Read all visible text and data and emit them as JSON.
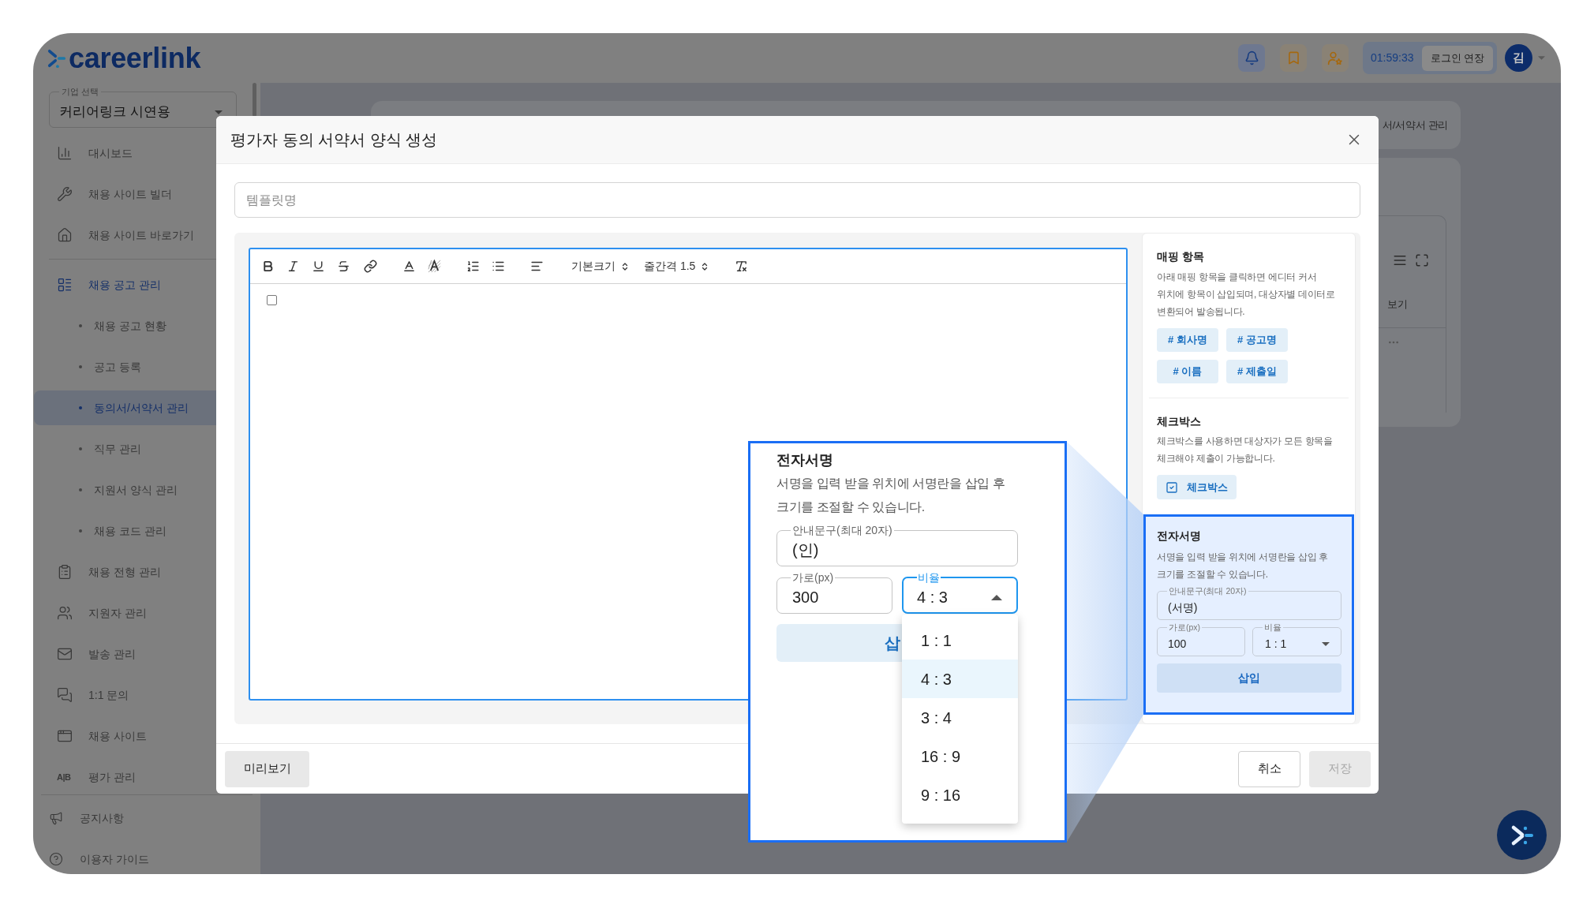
{
  "header": {
    "logo": "careerlink",
    "session_timer": "01:59:33",
    "extend_button": "로그인 연장",
    "avatar": "김"
  },
  "sidebar": {
    "company_select": {
      "label": "기업 선택",
      "value": "커리어링크 시연용"
    },
    "sections": [
      {
        "items": [
          {
            "label": "대시보드",
            "selected": false
          },
          {
            "label": "채용 사이트 빌더",
            "selected": false
          },
          {
            "label": "채용 사이트 바로가기",
            "selected": false
          }
        ]
      },
      {
        "items": [
          {
            "label": "채용 공고 관리",
            "selected": true,
            "children": [
              {
                "label": "채용 공고 현황",
                "selected": false
              },
              {
                "label": "공고 등록",
                "selected": false
              },
              {
                "label": "동의서/서약서 관리",
                "selected": true
              },
              {
                "label": "직무 관리",
                "selected": false
              },
              {
                "label": "지원서 양식 관리",
                "selected": false
              },
              {
                "label": "채용 코드 관리",
                "selected": false
              }
            ]
          },
          {
            "label": "채용 전형 관리",
            "selected": false
          },
          {
            "label": "지원자 관리",
            "selected": false
          },
          {
            "label": "발송 관리",
            "selected": false
          },
          {
            "label": "1:1 문의",
            "selected": false
          },
          {
            "label": "채용 사이트",
            "selected": false
          },
          {
            "label": "평가 관리",
            "selected": false,
            "icon_text": "A|B"
          }
        ]
      },
      {
        "items": [
          {
            "label": "공지사항",
            "selected": false
          },
          {
            "label": "이용자 가이드",
            "selected": false
          }
        ]
      }
    ]
  },
  "background": {
    "breadcrumb": "서/서약서 관리",
    "panel_label": "보기"
  },
  "modal": {
    "title": "평가자 동의 서약서 양식 생성",
    "template_name": {
      "placeholder": "템플릿명"
    },
    "toolbar": {
      "font_size": "기본크기",
      "line_spacing": "줄간격 1.5"
    },
    "editor": {
      "checkbox": {
        "checked": false
      }
    },
    "side_panel": {
      "mapping": {
        "title": "매핑 항목",
        "description": "아래 매핑 항목을 클릭하면 에디터 커서 위치에 항목이 삽입되며, 대상자별 데이터로 변환되어 발송됩니다.",
        "chips": [
          "# 회사명",
          "# 공고명",
          "# 이름",
          "# 제출일"
        ]
      },
      "checkbox": {
        "title": "체크박스",
        "description": "체크박스를 사용하면 대상자가 모든 항목을 체크해야 제출이 가능합니다.",
        "button": "체크박스"
      },
      "signature": {
        "highlighted": true,
        "title": "전자서명",
        "description": "서명을 입력 받을 위치에 서명란을 삽입 후 크기를 조절할 수 있습니다.",
        "guide_field": {
          "label": "안내문구(최대 20자)",
          "value": "(서명)"
        },
        "width_field": {
          "label": "가로(px)",
          "value": "100"
        },
        "ratio_select": {
          "label": "비율",
          "value": "1 : 1",
          "open": false
        },
        "insert_button": "삽입"
      }
    },
    "footer": {
      "preview_button": "미리보기",
      "cancel_button": "취소",
      "save_button": {
        "label": "저장",
        "disabled": true
      }
    }
  },
  "zoom_inset": {
    "title": "전자서명",
    "description": "서명을 입력 받을 위치에 서명란을 삽입 후 크기를 조절할 수 있습니다.",
    "guide_field": {
      "label": "안내문구(최대 20자)",
      "value": "(인)"
    },
    "width_field": {
      "label": "가로(px)",
      "value": "300"
    },
    "ratio_select": {
      "label": "비율",
      "value": "4 : 3",
      "open": true,
      "options": [
        {
          "label": "1 : 1",
          "selected": false
        },
        {
          "label": "4 : 3",
          "selected": true
        },
        {
          "label": "3 : 4",
          "selected": false
        },
        {
          "label": "16 : 9",
          "selected": false
        },
        {
          "label": "9 : 16",
          "selected": false
        }
      ]
    },
    "insert_button": "삽"
  }
}
